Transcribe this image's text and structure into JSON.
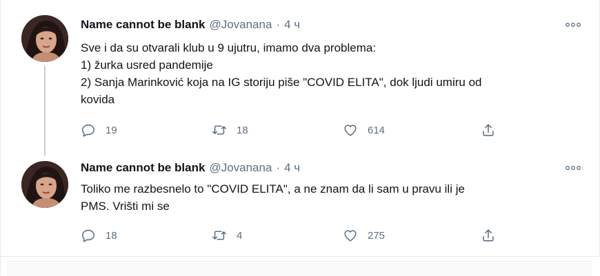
{
  "tweets": [
    {
      "display_name": "Name cannot be blank",
      "handle": "@Jovanana",
      "separator": "·",
      "time": "4 ч",
      "more_glyph": "ooo",
      "lines": [
        "Sve i da su otvarali klub u 9 ujutru, imamo dva problema:",
        "1) žurka usred pandemije",
        "2) Sanja Marinković koja na IG storiju piše \"COVID ELITA\", dok ljudi umiru od",
        "kovida"
      ],
      "replies": "19",
      "retweets": "18",
      "likes": "614",
      "avatar_icon": "profile-photo"
    },
    {
      "display_name": "Name cannot be blank",
      "handle": "@Jovanana",
      "separator": "·",
      "time": "4 ч",
      "more_glyph": "ooo",
      "lines": [
        "Toliko me razbesnelo to \"COVID ELITA\", a ne znam da li sam u pravu ili je",
        "PMS. Vrišti mi se"
      ],
      "replies": "18",
      "retweets": "4",
      "likes": "275",
      "avatar_icon": "profile-photo"
    }
  ],
  "icons": {
    "reply": "reply-icon",
    "retweet": "retweet-icon",
    "like": "heart-icon",
    "share": "share-icon",
    "more": "more-options-icon"
  },
  "colors": {
    "text": "#0f1419",
    "secondary": "#5b7083",
    "thread_line": "#c4cfd6",
    "border": "#e6ecf0"
  }
}
